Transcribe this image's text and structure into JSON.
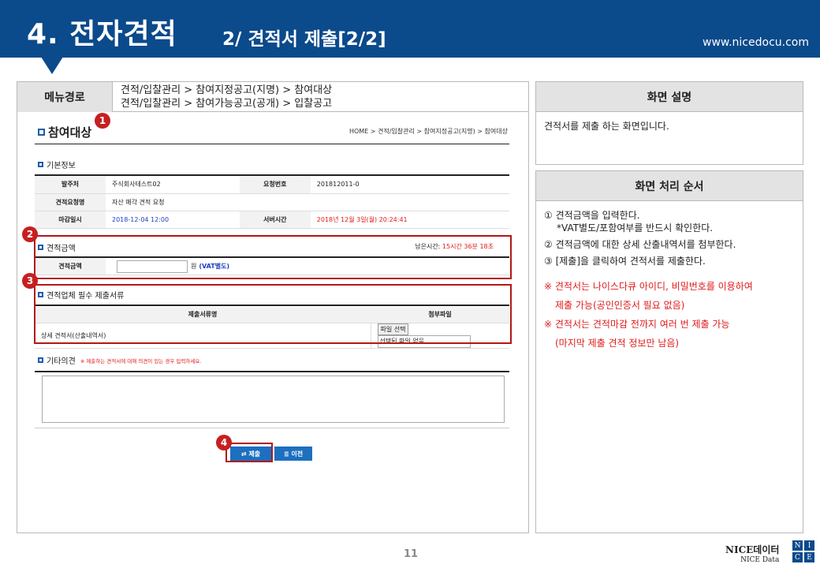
{
  "header": {
    "title": "4. 전자견적",
    "subtitle": "2/ 견적서 제출[2/2]",
    "url": "www.nicedocu.com"
  },
  "menu_path": {
    "label": "메뉴경로",
    "line1": "견적/입찰관리 > 참여지정공고(지명) > 참여대상",
    "line2": "견적/입찰관리 > 참여가능공고(공개) > 입찰공고"
  },
  "screen": {
    "title": "참여대상",
    "breadcrumb": "HOME > 견적/입찰관리 > 참여지정공고(지명) > 참여대상",
    "basic_info": {
      "title": "기본정보",
      "orderer_label": "발주처",
      "orderer_value": "주식회사테스트02",
      "request_no_label": "요청번호",
      "request_no_value": "201812011-0",
      "request_name_label": "견적요청명",
      "request_name_value": "자산 매각 견적 요청",
      "deadline_label": "마감일시",
      "deadline_value": "2018-12-04 12:00",
      "server_time_label": "서버시간",
      "server_time_value": "2018년 12월 3일(월) 20:24:41"
    },
    "amount": {
      "title": "견적금액",
      "remaining_label": "남은시간:",
      "remaining_value": "15시간 36분 18초",
      "field_label": "견적금액",
      "unit": "원",
      "vat_note": "(VAT별도)"
    },
    "docs": {
      "title": "견적업체 필수 제출서류",
      "col_name": "제출서류명",
      "col_file": "첨부파일",
      "row_name": "상세 견적서(산출내역서)",
      "file_button": "파일 선택",
      "file_status": "선택된 파일 없음"
    },
    "opinion": {
      "title": "기타의견",
      "hint": "※ 제출하는 견적서에 대해 의견이 있는 경우 입력하세요."
    },
    "submit_label": "⇄ 제출",
    "prev_label": "≣ 이전"
  },
  "badges": [
    "1",
    "2",
    "3",
    "4"
  ],
  "desc_panel": {
    "title": "화면 설명",
    "text": "견적서를 제출 하는 화면입니다."
  },
  "process_panel": {
    "title": "화면 처리 순서",
    "step1": "① 견적금액을 입력한다.",
    "step1b": "*VAT별도/포함여부를 반드시 확인한다.",
    "step2": "② 견적금액에 대한 상세 산출내역서를 첨부한다.",
    "step3": "③ [제출]을 클릭하여 견적서를 제출한다.",
    "note1": "※ 견적서는 나이스다큐 아이디, 비밀번호를 이용하여",
    "note1b": "제출 가능(공인인증서 필요 없음)",
    "note2": "※ 견적서는 견적마감 전까지 여러 번 제출 가능",
    "note2b": "(마지막 제출 견적 정보만 남음)"
  },
  "footer": {
    "page_number": "11",
    "logo_line1": "NICE데이터",
    "logo_line2": "NICE Data",
    "logo_letters": [
      "N",
      "I",
      "C",
      "E"
    ]
  },
  "colors": {
    "header_blue": "#0b4a8b",
    "highlight_red": "#b21818",
    "button_blue": "#1d6fc0"
  }
}
